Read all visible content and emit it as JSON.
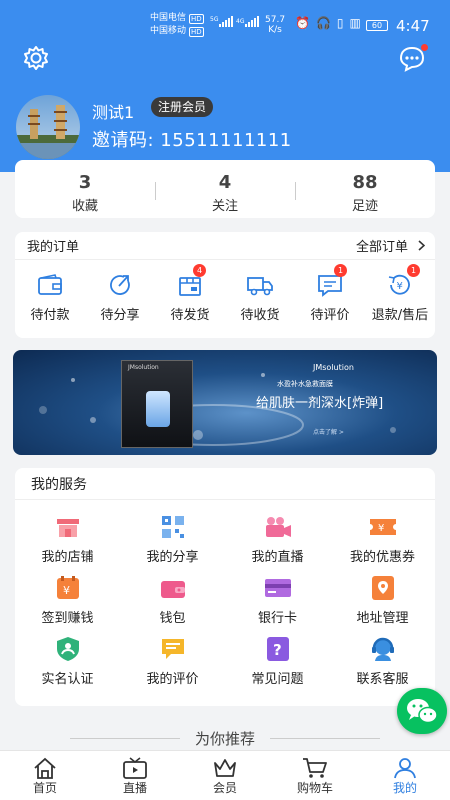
{
  "status_bar": {
    "carrier1": "中国电信",
    "carrier2": "中国移动",
    "hd": "HD",
    "net1": "5G",
    "net2": "4G",
    "speed_value": "57.7",
    "speed_unit": "K/s",
    "battery": "60",
    "time": "4:47"
  },
  "profile": {
    "username": "测试1",
    "member_badge": "注册会员",
    "invite_code": "邀请码: 15511111111"
  },
  "stats": [
    {
      "value": "3",
      "label": "收藏"
    },
    {
      "value": "4",
      "label": "关注"
    },
    {
      "value": "88",
      "label": "足迹"
    }
  ],
  "orders": {
    "title": "我的订单",
    "all_label": "全部订单",
    "items": [
      {
        "label": "待付款",
        "icon": "wallet-icon",
        "badge": ""
      },
      {
        "label": "待分享",
        "icon": "share-icon",
        "badge": ""
      },
      {
        "label": "待发货",
        "icon": "package-icon",
        "badge": "4"
      },
      {
        "label": "待收货",
        "icon": "truck-icon",
        "badge": ""
      },
      {
        "label": "待评价",
        "icon": "comment-icon",
        "badge": "1"
      },
      {
        "label": "退款/售后",
        "icon": "refund-icon",
        "badge": "1"
      }
    ]
  },
  "banner": {
    "brand": "JMsolution",
    "subtitle": "水盈补水急救面膜",
    "headline": "给肌肤一剂深水[炸弹]",
    "cta": "点击了解 >",
    "product_label": "JMsolution"
  },
  "services": {
    "title": "我的服务",
    "items": [
      {
        "label": "我的店铺",
        "icon": "shop-icon",
        "color": "#f06a78"
      },
      {
        "label": "我的分享",
        "icon": "qrcode-icon",
        "color": "#4a90e2"
      },
      {
        "label": "我的直播",
        "icon": "video-camera-icon",
        "color": "#f06a98"
      },
      {
        "label": "我的优惠券",
        "icon": "coupon-icon",
        "color": "#f5813a"
      },
      {
        "label": "签到赚钱",
        "icon": "checkin-coin-icon",
        "color": "#f5813a"
      },
      {
        "label": "钱包",
        "icon": "purse-icon",
        "color": "#ee5a8c"
      },
      {
        "label": "银行卡",
        "icon": "bank-card-icon",
        "color": "#b06ae0"
      },
      {
        "label": "地址管理",
        "icon": "location-icon",
        "color": "#f5813a"
      },
      {
        "label": "实名认证",
        "icon": "verified-user-icon",
        "color": "#2fb27a"
      },
      {
        "label": "我的评价",
        "icon": "review-icon",
        "color": "#f5b62a"
      },
      {
        "label": "常见问题",
        "icon": "question-icon",
        "color": "#8a5ae0"
      },
      {
        "label": "联系客服",
        "icon": "customer-service-icon",
        "color": "#3a8fe0"
      }
    ]
  },
  "recommend_title": "为你推荐",
  "tabbar": [
    {
      "label": "首页",
      "icon": "home-icon",
      "active": false
    },
    {
      "label": "直播",
      "icon": "tv-icon",
      "active": false
    },
    {
      "label": "会员",
      "icon": "crown-icon",
      "active": false
    },
    {
      "label": "购物车",
      "icon": "cart-icon",
      "active": false
    },
    {
      "label": "我的",
      "icon": "user-icon",
      "active": true
    }
  ],
  "colors": {
    "header": "#3b8def",
    "active_tab": "#2f7fe0",
    "badge": "#ff3b30",
    "wechat": "#07c160"
  }
}
